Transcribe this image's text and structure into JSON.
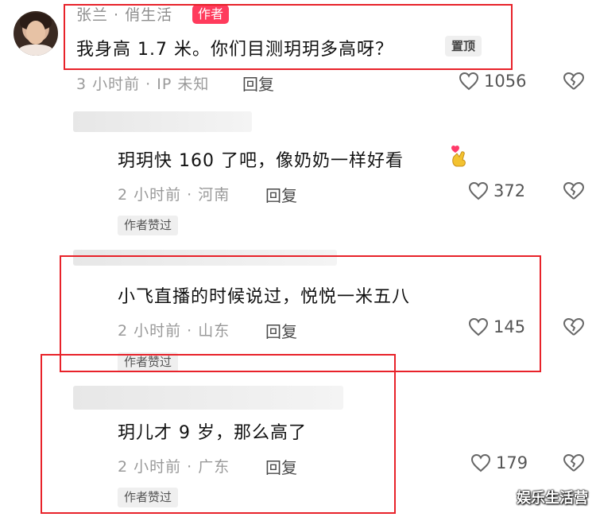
{
  "pinned_comment": {
    "author": "张兰 · 俏生活",
    "author_badge": "作者",
    "text": "我身高 1.7 米。你们目测玥玥多高呀？",
    "pin_label": "置顶",
    "meta": "3 小时前 · IP 未知",
    "reply_label": "回复",
    "likes": "1056"
  },
  "replies": [
    {
      "text": "玥玥快 160 了吧，像奶奶一样好看",
      "meta": "2 小时前 · 河南",
      "reply_label": "回复",
      "likes": "372",
      "liked_badge": "作者赞过",
      "emoji": "crossed-fingers-heart"
    },
    {
      "text": "小飞直播的时候说过，悦悦一米五八",
      "meta": "2 小时前 · 山东",
      "reply_label": "回复",
      "likes": "145",
      "liked_badge": "作者赞过"
    },
    {
      "text": "玥儿才 9 岁，那么高了",
      "meta": "2 小时前 · 广东",
      "reply_label": "回复",
      "likes": "179",
      "liked_badge": "作者赞过"
    }
  ],
  "watermark": "娱乐生活营",
  "colors": {
    "highlight_box": "#e8222a",
    "author_badge": "#ff3b5c"
  }
}
